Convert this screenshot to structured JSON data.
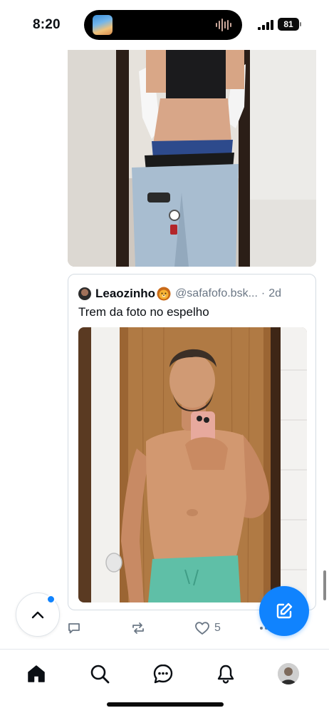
{
  "status_bar": {
    "time": "8:20",
    "battery": "81"
  },
  "quote": {
    "author_name": "Leaozinho",
    "author_emoji_icon": "lion-face-icon",
    "handle": "@safafofo.bsk...",
    "separator": "·",
    "age": "2d",
    "text": "Trem da foto no espelho"
  },
  "actions": {
    "reply_icon": "comment-icon",
    "repost_icon": "repost-icon",
    "like_icon": "heart-icon",
    "like_count": "5",
    "more_icon": "more-dots-icon"
  },
  "floating": {
    "scroll_top_icon": "chevron-up-icon",
    "compose_icon": "compose-icon"
  },
  "nav": {
    "items": [
      "home-icon",
      "search-icon",
      "chat-icon",
      "bell-icon",
      "profile-avatar"
    ]
  },
  "colors": {
    "accent": "#1083fe",
    "muted_text": "#6b7785",
    "border": "#d4dbe2"
  }
}
